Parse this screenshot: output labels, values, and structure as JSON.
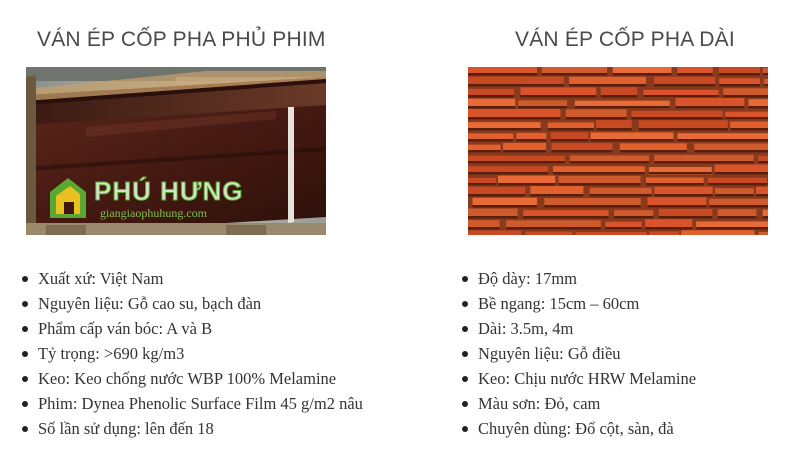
{
  "left": {
    "title": "VÁN ÉP CỐP PHA PHỦ PHIM",
    "logo": {
      "brand": "PHÚ HƯNG",
      "website": "giangiaophuhung.com"
    },
    "specs": [
      "Xuất xứ: Việt Nam",
      "Nguyên liệu: Gỗ cao su, bạch đàn",
      "Phẩm cấp ván bóc: A và B",
      "Tỷ trọng: >690 kg/m3",
      "Keo: Keo chống nước WBP 100% Melamine",
      "Phim: Dynea Phenolic Surface Film 45 g/m2 nâu",
      "Số lần sử dụng: lên đến 18"
    ]
  },
  "right": {
    "title": "VÁN ÉP CỐP PHA DÀI",
    "specs": [
      "Độ dày: 17mm",
      "Bề ngang: 15cm – 60cm",
      "Dài: 3.5m, 4m",
      "Nguyên liệu: Gỗ điều",
      "Keo: Chịu nước HRW Melamine",
      "Màu sơn: Đỏ, cam",
      "Chuyên dùng: Đổ cột, sàn, đà"
    ]
  },
  "colors": {
    "film_brown": "#4a1c14",
    "plank_orange": "#d9542a",
    "logo_green": "#5aa832",
    "logo_yellow": "#e8c020"
  }
}
